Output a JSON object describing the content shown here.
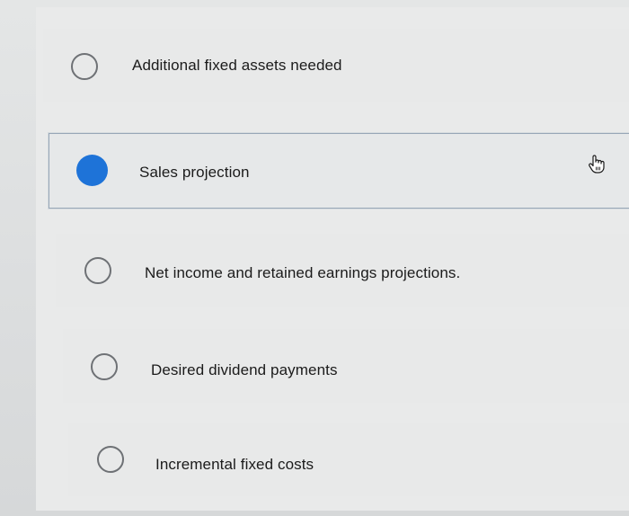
{
  "question": {
    "options": [
      {
        "label": "Additional fixed assets needed",
        "selected": false
      },
      {
        "label": "Sales projection",
        "selected": true
      },
      {
        "label": "Net income and retained earnings projections.",
        "selected": false
      },
      {
        "label": "Desired dividend payments",
        "selected": false
      },
      {
        "label": "Incremental fixed costs",
        "selected": false
      }
    ]
  },
  "cursor": {
    "icon": "hand-pointer-icon"
  },
  "colors": {
    "selected_radio": "#1e73d8",
    "selected_border": "#97a7b7"
  }
}
